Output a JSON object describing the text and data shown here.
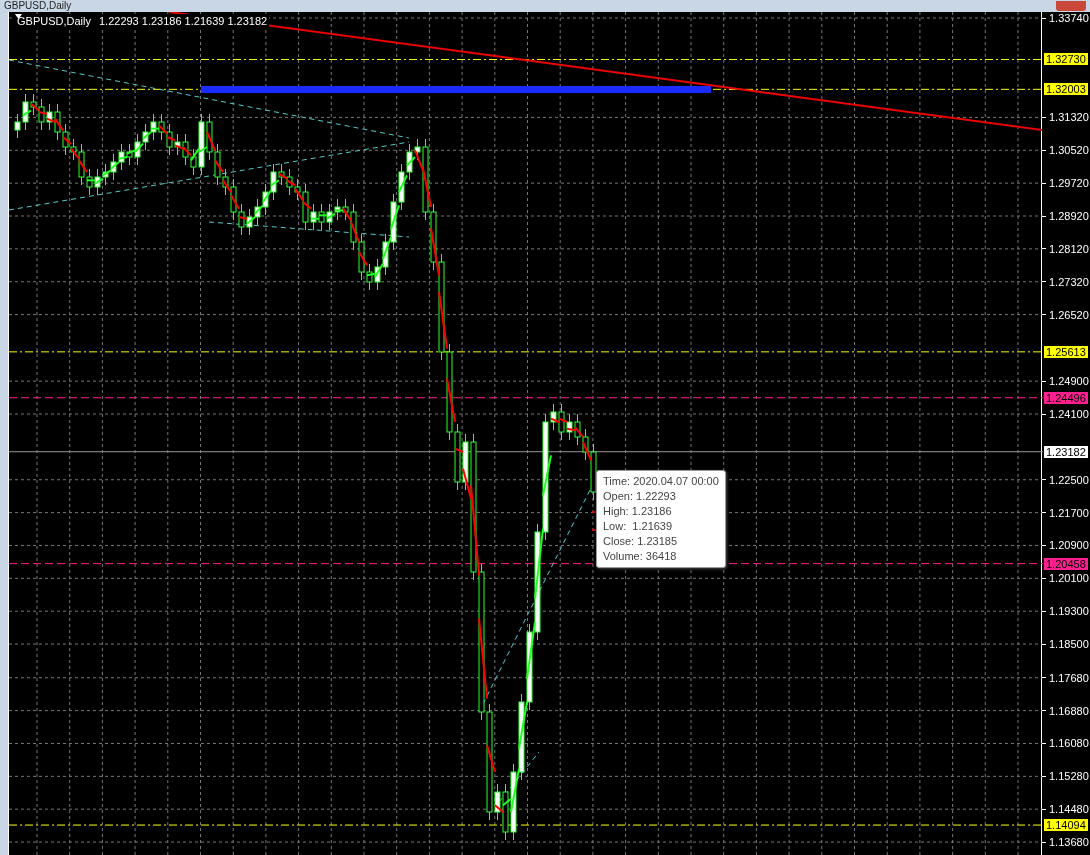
{
  "window": {
    "title": "GBPUSD,Daily"
  },
  "header": {
    "symbol": "GBPUSD,Daily",
    "values": "1.22293 1.23186 1.21639 1.23182"
  },
  "price_axis": {
    "ticks": [
      "1.33740",
      "1.31320",
      "1.30520",
      "1.29720",
      "1.28920",
      "1.28120",
      "1.27320",
      "1.26520",
      "1.24900",
      "1.24100",
      "1.22500",
      "1.21700",
      "1.20900",
      "1.20100",
      "1.19300",
      "1.18500",
      "1.17680",
      "1.16880",
      "1.16080",
      "1.15280",
      "1.14480",
      "1.13680"
    ]
  },
  "levels": [
    {
      "label": "1.32730",
      "color": "#ffff00",
      "kind": "dashdot"
    },
    {
      "label": "1.32003",
      "color": "#ffff00",
      "kind": "dashdot"
    },
    {
      "label": "1.25613",
      "color": "#ffff00",
      "kind": "dashdot"
    },
    {
      "label": "1.24496",
      "color": "#ff1f8f",
      "kind": "dashed"
    },
    {
      "label": "1.23182",
      "color": "#ffffff",
      "kind": "solid"
    },
    {
      "label": "1.20458",
      "color": "#ff1f8f",
      "kind": "dashed"
    },
    {
      "label": "1.14094",
      "color": "#ffff00",
      "kind": "dashdot"
    }
  ],
  "tooltip": {
    "lines": [
      "Time: 2020.04.07 00:00",
      "Open: 1.22293",
      "High: 1.23186",
      "Low:  1.21639",
      "Close: 1.23185",
      "Volume: 36418"
    ]
  }
}
